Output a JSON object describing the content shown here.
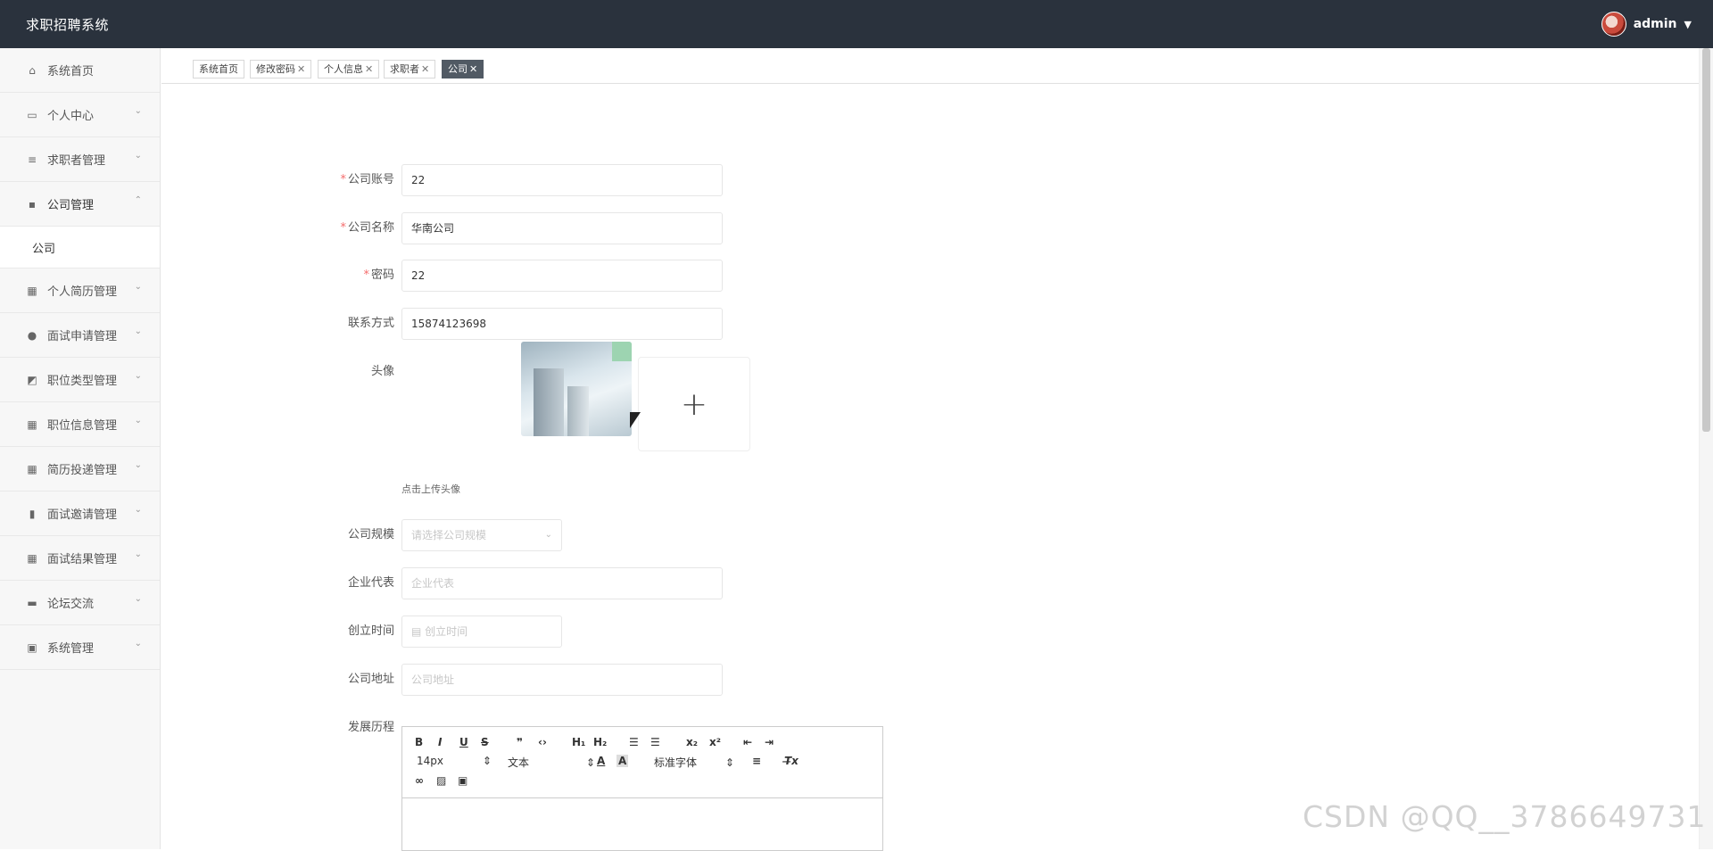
{
  "app": {
    "title": "求职招聘系统",
    "user": "admin"
  },
  "sidebar": {
    "items": [
      {
        "label": "系统首页",
        "icon": "home-icon"
      },
      {
        "label": "个人中心",
        "icon": "calendar-icon"
      },
      {
        "label": "求职者管理",
        "icon": "list-icon"
      },
      {
        "label": "公司管理",
        "icon": "chat-icon"
      },
      {
        "label": "个人简历管理",
        "icon": "grid-icon"
      },
      {
        "label": "面试申请管理",
        "icon": "user-icon"
      },
      {
        "label": "职位类型管理",
        "icon": "chart-icon"
      },
      {
        "label": "职位信息管理",
        "icon": "grid-icon"
      },
      {
        "label": "简历投递管理",
        "icon": "grid-icon"
      },
      {
        "label": "面试邀请管理",
        "icon": "bar-icon"
      },
      {
        "label": "面试结果管理",
        "icon": "grid-icon"
      },
      {
        "label": "论坛交流",
        "icon": "briefcase-icon"
      },
      {
        "label": "系统管理",
        "icon": "clipboard-icon"
      }
    ],
    "sub_company": "公司"
  },
  "tabs": [
    {
      "label": "系统首页"
    },
    {
      "label": "修改密码",
      "closable": true
    },
    {
      "label": "个人信息",
      "closable": true
    },
    {
      "label": "求职者",
      "closable": true
    },
    {
      "label": "公司",
      "closable": true,
      "active": true
    }
  ],
  "form": {
    "account": {
      "label": "公司账号",
      "value": "22"
    },
    "name": {
      "label": "公司名称",
      "value": "华南公司"
    },
    "password": {
      "label": "密码",
      "value": "22"
    },
    "contact": {
      "label": "联系方式",
      "value": "15874123698"
    },
    "avatar": {
      "label": "头像",
      "hint": "点击上传头像"
    },
    "scale": {
      "label": "公司规模",
      "placeholder": "请选择公司规模"
    },
    "representative": {
      "label": "企业代表",
      "placeholder": "企业代表"
    },
    "founded": {
      "label": "创立时间",
      "placeholder": "创立时间"
    },
    "address": {
      "label": "公司地址",
      "placeholder": "公司地址"
    },
    "history": {
      "label": "发展历程"
    }
  },
  "editor": {
    "font_size": "14px",
    "format": "文本",
    "font": "标准字体"
  },
  "watermark": "CSDN @QQ__3786649731",
  "colors": {
    "topbar": "#2a323d",
    "active_tab": "#515a64",
    "required": "#f56c6c"
  }
}
